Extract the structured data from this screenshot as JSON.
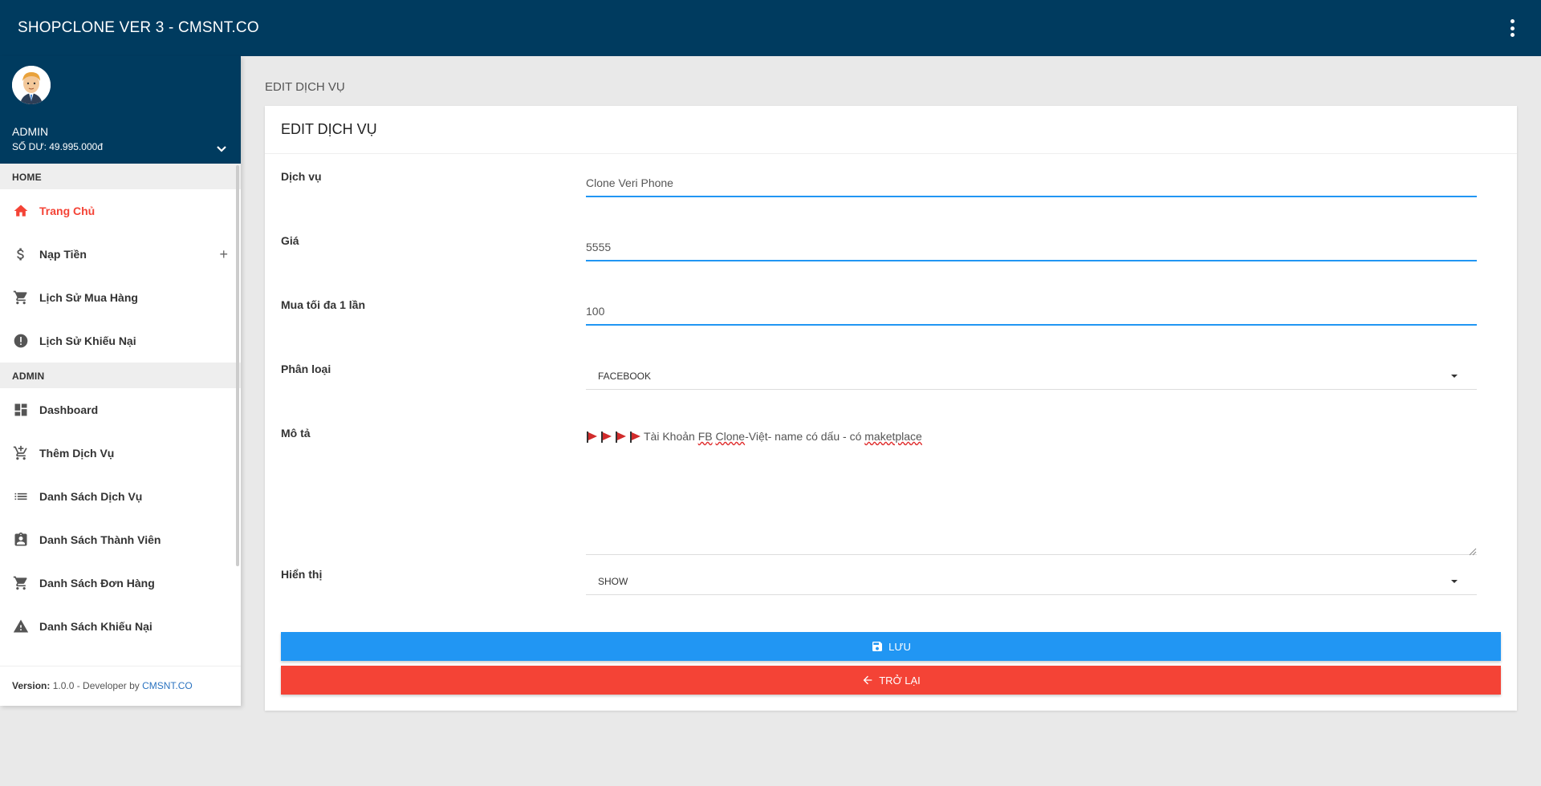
{
  "app": {
    "title": "SHOPCLONE VER 3 - CMSNT.CO"
  },
  "user": {
    "name": "ADMIN",
    "balance": "SỐ DƯ: 49.995.000đ"
  },
  "sidebar": {
    "sections": [
      {
        "header": "HOME",
        "items": [
          {
            "label": "Trang Chủ",
            "icon": "home-icon",
            "active": true
          },
          {
            "label": "Nạp Tiền",
            "icon": "dollar-icon",
            "expandable": true
          },
          {
            "label": "Lịch Sử Mua Hàng",
            "icon": "cart-icon"
          },
          {
            "label": "Lịch Sử Khiếu Nại",
            "icon": "alert-circle-icon"
          }
        ]
      },
      {
        "header": "ADMIN",
        "items": [
          {
            "label": "Dashboard",
            "icon": "dashboard-icon"
          },
          {
            "label": "Thêm Dịch Vụ",
            "icon": "add-cart-icon"
          },
          {
            "label": "Danh Sách Dịch Vụ",
            "icon": "list-icon"
          },
          {
            "label": "Danh Sách Thành Viên",
            "icon": "badge-icon"
          },
          {
            "label": "Danh Sách Đơn Hàng",
            "icon": "cart-icon"
          },
          {
            "label": "Danh Sách Khiếu Nại",
            "icon": "warning-icon"
          }
        ]
      }
    ],
    "expand_symbol": "+"
  },
  "footer": {
    "version_label": "Version:",
    "version_text": " 1.0.0 - Developer by ",
    "developer_link": "CMSNT.CO"
  },
  "page": {
    "breadcrumb_title": "EDIT DỊCH VỤ",
    "card_title": "EDIT DỊCH VỤ"
  },
  "form": {
    "service": {
      "label": "Dịch vụ",
      "value": "Clone Veri Phone"
    },
    "price": {
      "label": "Giá",
      "value": "5555"
    },
    "max_buy": {
      "label": "Mua tối đa 1 lần",
      "value": "100"
    },
    "category": {
      "label": "Phân loại",
      "selected": "FACEBOOK"
    },
    "description": {
      "label": "Mô tả",
      "text_before": "Tài Khoản ",
      "word_fb": "FB",
      "text_space": " ",
      "word_clone": "Clone",
      "text_middle": "-Việt- name có dấu - có ",
      "word_market": "maketplace"
    },
    "display": {
      "label": "Hiển thị",
      "selected": "SHOW"
    }
  },
  "buttons": {
    "save": "LƯU",
    "back": "TRỞ LẠI"
  },
  "colors": {
    "topbar": "#003b5f",
    "accent_blue": "#2196f3",
    "accent_red": "#f44336",
    "active_menu": "#f44336"
  }
}
